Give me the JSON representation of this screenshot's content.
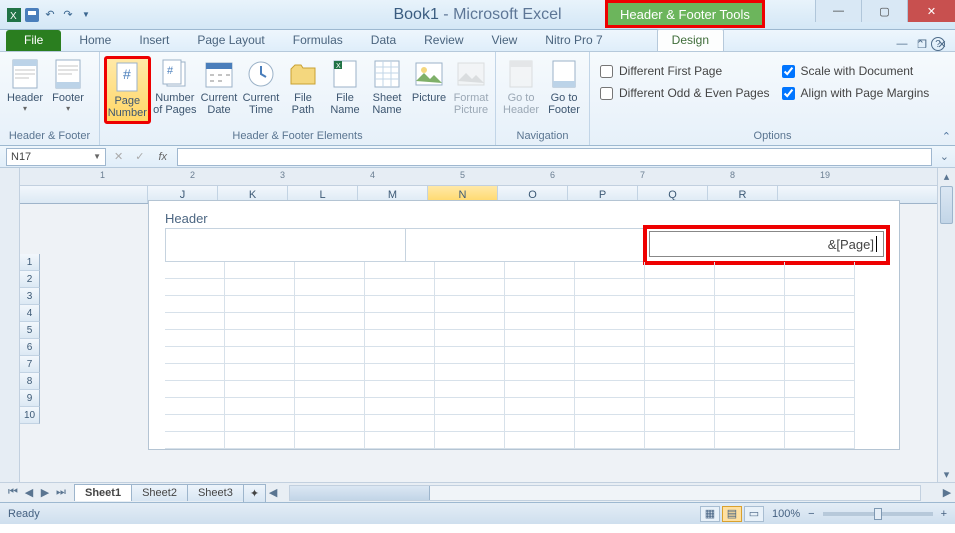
{
  "title": {
    "doc": "Book1",
    "sep": " - ",
    "app": "Microsoft Excel"
  },
  "contextual_tab": "Header & Footer Tools",
  "menu": {
    "file": "File",
    "tabs": [
      "Home",
      "Insert",
      "Page Layout",
      "Formulas",
      "Data",
      "Review",
      "View",
      "Nitro Pro 7"
    ],
    "design": "Design"
  },
  "ribbon": {
    "grp1": {
      "label": "Header & Footer",
      "header": "Header",
      "footer": "Footer"
    },
    "grp2": {
      "label": "Header & Footer Elements",
      "page_number": "Page\nNumber",
      "number_of_pages": "Number\nof Pages",
      "current_date": "Current\nDate",
      "current_time": "Current\nTime",
      "file_path": "File\nPath",
      "file_name": "File\nName",
      "sheet_name": "Sheet\nName",
      "picture": "Picture",
      "format_picture": "Format\nPicture"
    },
    "grp3": {
      "label": "Navigation",
      "goto_header": "Go to\nHeader",
      "goto_footer": "Go to\nFooter"
    },
    "grp4": {
      "label": "Options",
      "diff_first": "Different First Page",
      "diff_oddeven": "Different Odd & Even Pages",
      "scale_doc": "Scale with Document",
      "align_margins": "Align with Page Margins"
    }
  },
  "formula_bar": {
    "cell_ref": "N17",
    "fx": "fx",
    "value": ""
  },
  "columns": [
    "J",
    "K",
    "L",
    "M",
    "N",
    "O",
    "P",
    "Q",
    "R"
  ],
  "active_col": "N",
  "rows": [
    1,
    2,
    3,
    4,
    5,
    6,
    7,
    8,
    9,
    10
  ],
  "header_section": {
    "label": "Header",
    "right_value": "&[Page]"
  },
  "sheets": {
    "tabs": [
      "Sheet1",
      "Sheet2",
      "Sheet3"
    ],
    "active": "Sheet1"
  },
  "status": {
    "ready": "Ready",
    "zoom": "100%"
  }
}
